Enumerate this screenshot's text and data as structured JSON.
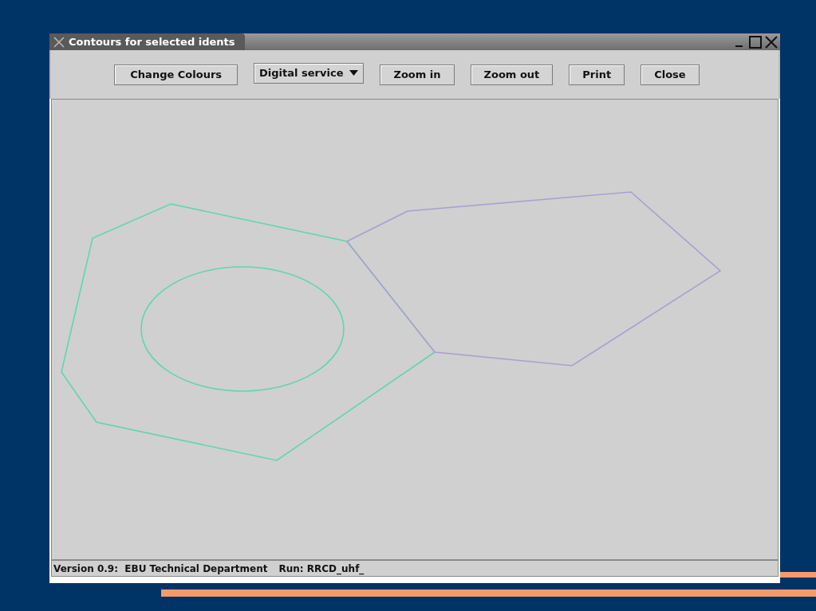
{
  "window": {
    "title": "Contours for selected idents"
  },
  "toolbar": [
    {
      "kind": "button",
      "label": "Change Colours"
    },
    {
      "kind": "dropdown",
      "label": "Digital service"
    },
    {
      "kind": "button",
      "label": "Zoom in"
    },
    {
      "kind": "button",
      "label": "Zoom out"
    },
    {
      "kind": "button",
      "label": "Print"
    },
    {
      "kind": "button",
      "label": "Close"
    }
  ],
  "status_bar": {
    "version": "Version 0.9:  EBU Technical Department",
    "run": "Run: RRCD_uhf_"
  }
}
